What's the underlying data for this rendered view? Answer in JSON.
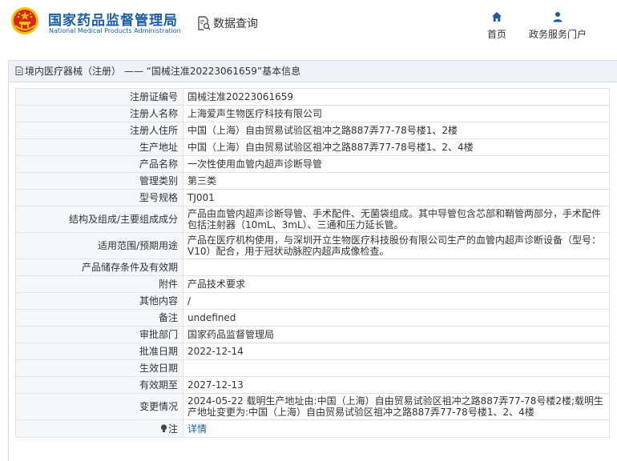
{
  "header": {
    "org_name_cn": "国家药品监督管理局",
    "org_name_en": "National Medical Products Administration",
    "query_label": "数据查询",
    "nav": [
      {
        "label": "首页",
        "icon": "home-icon"
      },
      {
        "label": "政务服务门户",
        "icon": "user-icon"
      }
    ]
  },
  "panel": {
    "category": "境内医疗器械（注册）",
    "separator": " —— ",
    "quote_open": "“",
    "registration_id": "国械注准20223061659",
    "quote_close": "”",
    "suffix": "基本信息"
  },
  "rows": [
    {
      "label": "注册证编号",
      "value": "国械注准20223061659"
    },
    {
      "label": "注册人名称",
      "value": "上海爱声生物医疗科技有限公司"
    },
    {
      "label": "注册人住所",
      "value": "中国（上海）自由贸易试验区祖冲之路887弄77-78号楼1、2楼"
    },
    {
      "label": "生产地址",
      "value": "中国（上海）自由贸易试验区祖冲之路887弄77-78号楼1、2、4楼"
    },
    {
      "label": "产品名称",
      "value": "一次性使用血管内超声诊断导管"
    },
    {
      "label": "管理类别",
      "value": "第三类"
    },
    {
      "label": "型号规格",
      "value": "TJ001"
    },
    {
      "label": "结构及组成/主要组成成分",
      "value": "产品由血管内超声诊断导管、手术配件、无菌袋组成。其中导管包含芯部和鞘管两部分，手术配件包括注射器（10mL、3mL）、三通和压力延长管。"
    },
    {
      "label": "适用范围/预期用途",
      "value": "产品在医疗机构使用，与深圳开立生物医疗科技股份有限公司生产的血管内超声诊断设备（型号：V10）配合，用于冠状动脉腔内超声成像检查。"
    },
    {
      "label": "产品储存条件及有效期",
      "value": ""
    },
    {
      "label": "附件",
      "value": "产品技术要求"
    },
    {
      "label": "其他内容",
      "value": "/"
    },
    {
      "label": "备注",
      "value": "undefined"
    },
    {
      "label": "审批部门",
      "value": "国家药品监督管理局"
    },
    {
      "label": "批准日期",
      "value": "2022-12-14"
    },
    {
      "label": "生效日期",
      "value": ""
    },
    {
      "label": "有效期至",
      "value": "2027-12-13"
    },
    {
      "label": "变更情况",
      "value": "2024-05-22 载明生产地址由:中国（上海）自由贸易试验区祖冲之路887弄77-78号楼2楼;载明生产地址变更为:中国（上海）自由贸易试验区祖冲之路887弄77-78号楼1、2、4楼"
    }
  ],
  "note_row": {
    "label": "注",
    "icon": "lightbulb-icon",
    "link": "详情"
  },
  "colors": {
    "brand_blue": "#1b5ea8",
    "emblem_red": "#d7261e",
    "emblem_gold": "#f2c200"
  }
}
